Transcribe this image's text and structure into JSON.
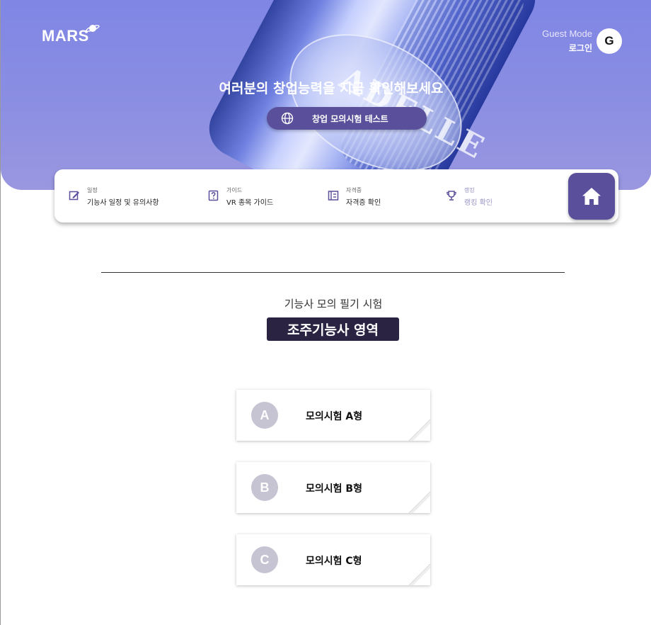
{
  "header": {
    "logo": "MARS",
    "guest_mode": "Guest Mode",
    "login": "로그인",
    "avatar_letter": "G",
    "headline": "여러분의 창업능력을 지금 확인해보세요",
    "cta_label": "창업 모의시험 테스트",
    "bottle_label_text": "ADELLE"
  },
  "nav": {
    "items": [
      {
        "small": "일정",
        "main": "기능사 일정 및 유의사항",
        "icon": "edit-icon"
      },
      {
        "small": "가이드",
        "main": "VR 종목 가이드",
        "icon": "question-icon"
      },
      {
        "small": "자격증",
        "main": "자격증 확인",
        "icon": "certificate-icon"
      },
      {
        "small": "랭킹",
        "main": "랭킹 확인",
        "icon": "trophy-icon"
      }
    ],
    "home_icon": "home-icon"
  },
  "exam": {
    "subtitle": "기능사 모의 필기 시험",
    "category": "조주기능사 영역",
    "cards": [
      {
        "letter": "A",
        "title": "모의시험 A형"
      },
      {
        "letter": "B",
        "title": "모의시험 B형"
      },
      {
        "letter": "C",
        "title": "모의시험 C형"
      }
    ]
  },
  "colors": {
    "hero": "#8b8ee2",
    "accent": "#5a4f9a",
    "badge": "#2a2342",
    "card_letter": "#c6c3d2"
  }
}
